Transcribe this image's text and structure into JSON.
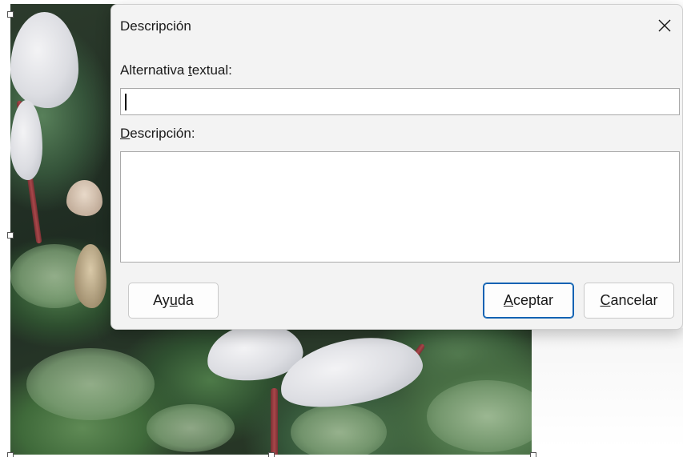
{
  "dialog": {
    "title": "Descripción",
    "close_icon": "close-icon",
    "alt_text": {
      "label_before": "Alternativa ",
      "label_accel": "t",
      "label_after": "extual:",
      "value": ""
    },
    "description": {
      "label_accel": "D",
      "label_after": "escripción:",
      "value": ""
    },
    "buttons": {
      "help": {
        "before": "Ay",
        "accel": "u",
        "after": "da"
      },
      "ok": {
        "before": "",
        "accel": "A",
        "after": "ceptar"
      },
      "cancel": {
        "before": "",
        "accel": "C",
        "after": "ancelar"
      }
    }
  },
  "colors": {
    "dialog_bg": "#f3f3f3",
    "primary_border": "#0f62b3"
  }
}
